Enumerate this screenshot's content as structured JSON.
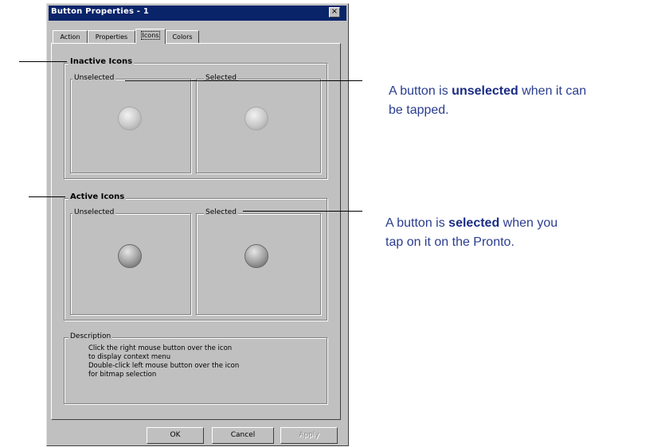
{
  "window": {
    "title": "Button Properties - 1",
    "close_glyph": "×"
  },
  "tabs": [
    {
      "label": "Action"
    },
    {
      "label": "Properties"
    },
    {
      "label": "Icons"
    },
    {
      "label": "Colors"
    }
  ],
  "active_tab": "Icons",
  "inactive_group": {
    "title": "Inactive Icons",
    "unselected_label": "Unselected",
    "selected_label": "Selected"
  },
  "active_group": {
    "title": "Active Icons",
    "unselected_label": "Unselected",
    "selected_label": "Selected"
  },
  "description": {
    "title": "Description",
    "lines": [
      "Click the right mouse button over the icon",
      "to display context menu",
      "Double-click left mouse button over the icon",
      "for bitmap selection"
    ]
  },
  "buttons": {
    "ok": "OK",
    "cancel": "Cancel",
    "apply": "Apply"
  },
  "annotations": {
    "unselected": {
      "before": "A button is ",
      "bold": "unselected",
      "after_line1": " when it can",
      "line2": "be tapped."
    },
    "selected": {
      "before": "A button is ",
      "bold": "selected",
      "after_line1": " when you",
      "line2": "tap on it on the Pronto."
    }
  },
  "colors": {
    "titlebar": "#0a246a",
    "dialog_face": "#c0c0c0",
    "annotation_text": "#2a3d8f"
  },
  "icons": {
    "inactive_unselected": "round-button-icon",
    "inactive_selected": "round-button-icon",
    "active_unselected": "round-button-icon",
    "active_selected": "round-button-icon"
  }
}
